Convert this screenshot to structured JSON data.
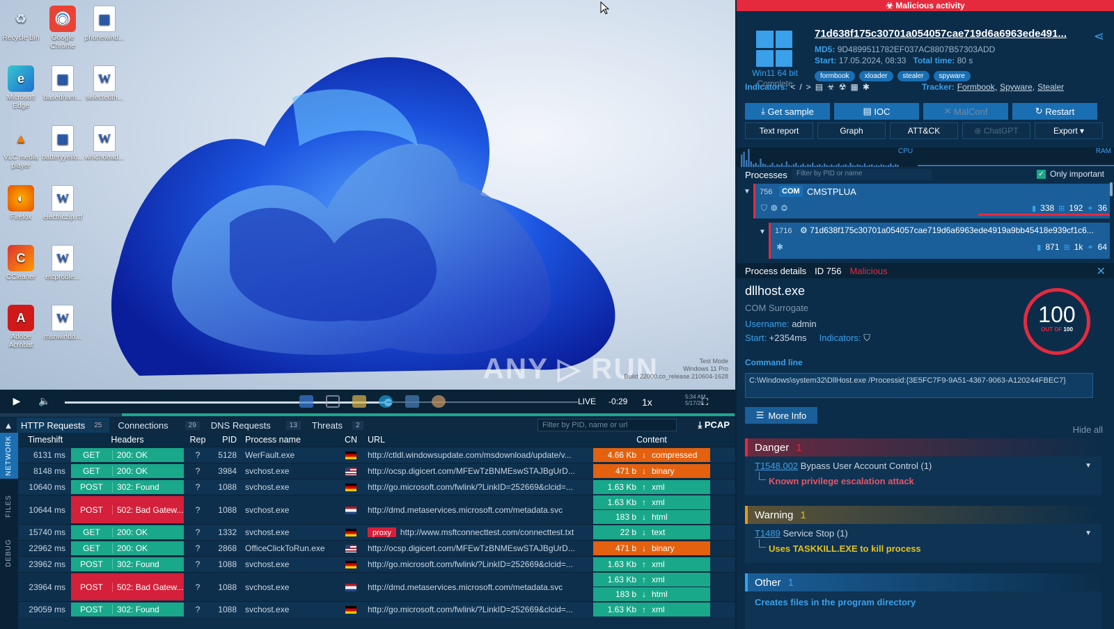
{
  "desktop": {
    "icons": [
      {
        "label": "Recycle Bin",
        "glyph": "♻",
        "kind": "recycle"
      },
      {
        "label": "Google Chrome",
        "glyph": "◉",
        "kind": "chrome"
      },
      {
        "label": "phonewind...",
        "glyph": "▦",
        "kind": "doc"
      },
      {
        "label": "Microsoft Edge",
        "glyph": "e",
        "kind": "edge"
      },
      {
        "label": "basednam...",
        "glyph": "▦",
        "kind": "doc"
      },
      {
        "label": "selectedth...",
        "glyph": "W",
        "kind": "word"
      },
      {
        "label": "VLC media player",
        "glyph": "▲",
        "kind": "vlc"
      },
      {
        "label": "batteryyello...",
        "glyph": "▦",
        "kind": "doc"
      },
      {
        "label": "whichdead...",
        "glyph": "W",
        "kind": "word"
      },
      {
        "label": "Firefox",
        "glyph": "◐",
        "kind": "firefox"
      },
      {
        "label": "electriczip.rtf",
        "glyph": "W",
        "kind": "word"
      },
      {
        "label": "CCleaner",
        "glyph": "C",
        "kind": "ccleaner"
      },
      {
        "label": "etcproble...",
        "glyph": "W",
        "kind": "word"
      },
      {
        "label": "Adobe Acrobat",
        "glyph": "A",
        "kind": "acrobat"
      },
      {
        "label": "msnwindo...",
        "glyph": "W",
        "kind": "word"
      }
    ],
    "watermark": "ANY ▷ RUN",
    "test_mode": [
      "Test Mode",
      "Windows 11 Pro",
      "Build 22000.co_release.210604-1628"
    ]
  },
  "player": {
    "live": "LIVE",
    "time": "-0:29",
    "speed": "1x",
    "clock": "5:34 AM",
    "date": "5/17/20",
    "progress_percent": 44
  },
  "bottom_tabs": [
    {
      "label": "HTTP Requests",
      "count": "25"
    },
    {
      "label": "Connections",
      "count": "29"
    },
    {
      "label": "DNS Requests",
      "count": "13"
    },
    {
      "label": "Threats",
      "count": "2"
    }
  ],
  "bottom_filter_placeholder": "Filter by PID, name or url",
  "pcap_label": "PCAP",
  "side_tabs": [
    "NETWORK",
    "FILES",
    "DEBUG"
  ],
  "http": {
    "columns": [
      "Timeshift",
      "Headers",
      "Rep",
      "PID",
      "Process name",
      "CN",
      "URL",
      "Content"
    ],
    "rows": [
      {
        "ts": "6131 ms",
        "method": "GET",
        "status": "200: OK",
        "bad": false,
        "rep": "?",
        "pid": "5128",
        "proc": "WerFault.exe",
        "cn": "de",
        "url": "http://ctldl.windowsupdate.com/msdownload/update/v...",
        "proxy": "",
        "content": [
          {
            "size": "4.66 Kb",
            "dir": "↓",
            "type": "compressed",
            "color": "orange"
          }
        ]
      },
      {
        "ts": "8148 ms",
        "method": "GET",
        "status": "200: OK",
        "bad": false,
        "rep": "?",
        "pid": "3984",
        "proc": "svchost.exe",
        "cn": "us",
        "url": "http://ocsp.digicert.com/MFEwTzBNMEswSTAJBgUrD...",
        "proxy": "",
        "content": [
          {
            "size": "471 b",
            "dir": "↓",
            "type": "binary",
            "color": "orange"
          }
        ]
      },
      {
        "ts": "10640 ms",
        "method": "POST",
        "status": "302: Found",
        "bad": false,
        "rep": "?",
        "pid": "1088",
        "proc": "svchost.exe",
        "cn": "de",
        "url": "http://go.microsoft.com/fwlink/?LinkID=252669&clcid=...",
        "proxy": "",
        "content": [
          {
            "size": "1.63 Kb",
            "dir": "↑",
            "type": "xml",
            "color": "green"
          }
        ]
      },
      {
        "ts": "10644 ms",
        "method": "POST",
        "status": "502: Bad Gatew...",
        "bad": true,
        "rep": "?",
        "pid": "1088",
        "proc": "svchost.exe",
        "cn": "nl",
        "url": "http://dmd.metaservices.microsoft.com/metadata.svc",
        "proxy": "",
        "content": [
          {
            "size": "1.63 Kb",
            "dir": "↑",
            "type": "xml",
            "color": "green"
          },
          {
            "size": "183 b",
            "dir": "↓",
            "type": "html",
            "color": "green"
          }
        ]
      },
      {
        "ts": "15740 ms",
        "method": "GET",
        "status": "200: OK",
        "bad": false,
        "rep": "?",
        "pid": "1332",
        "proc": "svchost.exe",
        "cn": "de",
        "url": "http://www.msftconnecttest.com/connecttest.txt",
        "proxy": "proxy",
        "content": [
          {
            "size": "22 b",
            "dir": "↓",
            "type": "text",
            "color": "green"
          }
        ]
      },
      {
        "ts": "22962 ms",
        "method": "GET",
        "status": "200: OK",
        "bad": false,
        "rep": "?",
        "pid": "2868",
        "proc": "OfficeClickToRun.exe",
        "cn": "us",
        "url": "http://ocsp.digicert.com/MFEwTzBNMEswSTAJBgUrD...",
        "proxy": "",
        "content": [
          {
            "size": "471 b",
            "dir": "↓",
            "type": "binary",
            "color": "orange"
          }
        ]
      },
      {
        "ts": "23962 ms",
        "method": "POST",
        "status": "302: Found",
        "bad": false,
        "rep": "?",
        "pid": "1088",
        "proc": "svchost.exe",
        "cn": "de",
        "url": "http://go.microsoft.com/fwlink/?LinkID=252669&clcid=...",
        "proxy": "",
        "content": [
          {
            "size": "1.63 Kb",
            "dir": "↑",
            "type": "xml",
            "color": "green"
          }
        ]
      },
      {
        "ts": "23964 ms",
        "method": "POST",
        "status": "502: Bad Gatew...",
        "bad": true,
        "rep": "?",
        "pid": "1088",
        "proc": "svchost.exe",
        "cn": "nl",
        "url": "http://dmd.metaservices.microsoft.com/metadata.svc",
        "proxy": "",
        "content": [
          {
            "size": "1.63 Kb",
            "dir": "↑",
            "type": "xml",
            "color": "green"
          },
          {
            "size": "183 b",
            "dir": "↓",
            "type": "html",
            "color": "green"
          }
        ]
      },
      {
        "ts": "29059 ms",
        "method": "POST",
        "status": "302: Found",
        "bad": false,
        "rep": "?",
        "pid": "1088",
        "proc": "svchost.exe",
        "cn": "de",
        "url": "http://go.microsoft.com/fwlink/?LinkID=252669&clcid=...",
        "proxy": "",
        "content": [
          {
            "size": "1.63 Kb",
            "dir": "↑",
            "type": "xml",
            "color": "green"
          }
        ]
      }
    ]
  },
  "right": {
    "banner": "Malicious activity",
    "hash": "71d638f175c30701a054057cae719d6a6963ede491...",
    "md5_label": "MD5:",
    "md5": "9D4899511782EF037AC8807B57303ADD",
    "start_label": "Start:",
    "start": "17.05.2024, 08:33",
    "total_label": "Total time:",
    "total": "80 s",
    "os": "Win11 64 bit",
    "status": "Complete",
    "tags": [
      "formbook",
      "xloader",
      "stealer",
      "spyware"
    ],
    "indicators_label": "Indicators:",
    "tracker_label": "Tracker:",
    "trackers": [
      "Formbook,",
      "Spyware,",
      "Stealer"
    ],
    "buttons1": [
      "Get sample",
      "IOC",
      "MalConf",
      "Restart"
    ],
    "buttons2": [
      "Text report",
      "Graph",
      "ATT&CK",
      "ChatGPT",
      "Export"
    ],
    "cpu_label": "CPU",
    "ram_label": "RAM",
    "processes_label": "Processes",
    "proc_filter_placeholder": "Filter by PID or name",
    "only_important": "Only important",
    "procs": [
      {
        "pid": "756",
        "tag": "COM",
        "name": "CMSTPLUA",
        "files": "338",
        "reg": "192",
        "net": "36"
      },
      {
        "pid": "1716",
        "tag": "",
        "name": "71d638f175c30701a054057cae719d6a6963ede4919a9bb45418e939cf1c6...",
        "files": "871",
        "reg": "1k",
        "net": "64"
      }
    ],
    "pd_label": "Process details",
    "pd_id": "ID 756",
    "pd_status": "Malicious",
    "exe": "dllhost.exe",
    "desc": "COM Surrogate",
    "username_label": "Username:",
    "username": "admin",
    "pstart_label": "Start:",
    "pstart": "+2354ms",
    "pind_label": "Indicators:",
    "score": "100",
    "out_of": "OUT OF",
    "out_of_val": "100",
    "cmd_label": "Command line",
    "cmd": "C:\\Windows\\system32\\DllHost.exe /Processid:{3E5FC7F9-9A51-4367-9063-A120244FBEC7}",
    "more_info": "More Info",
    "hide_all": "Hide all",
    "danger": {
      "title": "Danger",
      "count": "1",
      "tid": "T1548.002",
      "text": "Bypass User Account Control (1)",
      "sub": "Known privilege escalation attack"
    },
    "warning": {
      "title": "Warning",
      "count": "1",
      "tid": "T1489",
      "text": "Service Stop (1)",
      "sub": "Uses TASKKILL.EXE to kill process"
    },
    "other": {
      "title": "Other",
      "count": "1",
      "sub": "Creates files in the program directory"
    }
  },
  "colors": {
    "accent": "#3aa0ea",
    "danger": "#e52a3d",
    "ok": "#1aa88a",
    "orange": "#e4610f"
  }
}
